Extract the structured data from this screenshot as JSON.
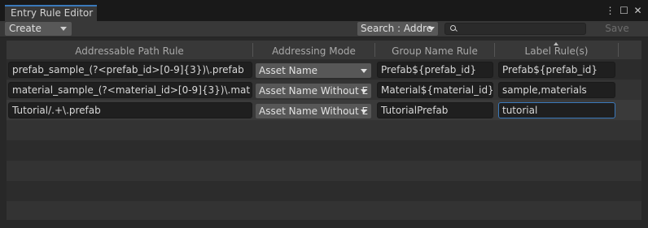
{
  "window": {
    "tab_title": "Entry Rule Editor",
    "menu_icon": "kebab-menu-icon",
    "maximize_icon": "maximize-icon",
    "close_icon": "close-icon"
  },
  "toolbar": {
    "create_label": "Create",
    "search_mode_label": "Search : Addre",
    "search_value": "",
    "save_label": "Save"
  },
  "columns": [
    "Addressable Path Rule",
    "Addressing Mode",
    "Group Name Rule",
    "Label Rule(s)"
  ],
  "rows": [
    {
      "path": "prefab_sample_(?<prefab_id>[0-9]{3})\\.prefab",
      "mode": "Asset Name",
      "group": "Prefab${prefab_id}",
      "labels": "Prefab${prefab_id}"
    },
    {
      "path": "material_sample_(?<material_id>[0-9]{3})\\.mat",
      "mode": "Asset Name Without E",
      "group": "Material${material_id}",
      "labels": "sample,materials"
    },
    {
      "path": "Tutorial/.+\\.prefab",
      "mode": "Asset Name Without E",
      "group": "TutorialPrefab",
      "labels": "tutorial"
    }
  ]
}
